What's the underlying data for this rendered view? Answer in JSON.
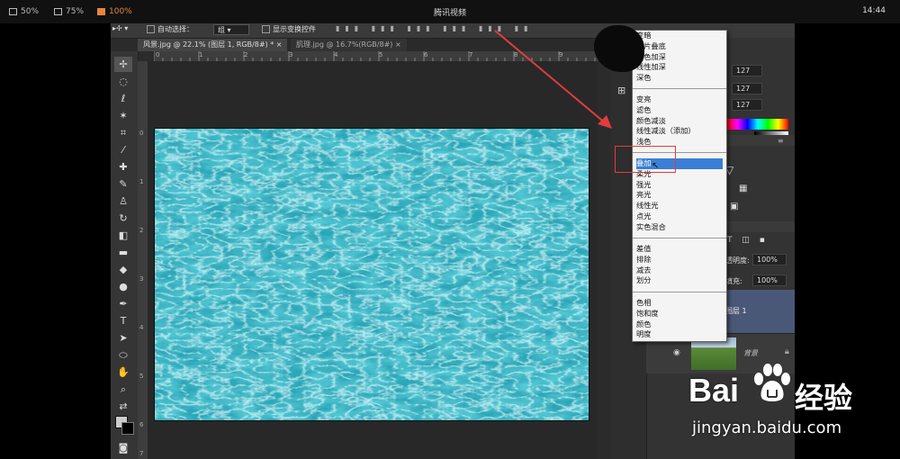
{
  "player": {
    "title": "腾讯视频",
    "clock": "14:44",
    "zoom_options": [
      {
        "label": "50%",
        "active": false
      },
      {
        "label": "75%",
        "active": false
      },
      {
        "label": "100%",
        "active": true
      }
    ]
  },
  "options_bar": {
    "auto_select_label": "自动选择：",
    "auto_select_value": "组",
    "show_transform_label": "显示变换控件"
  },
  "tabs": [
    {
      "label": "风景.jpg @ 22.1% (图层 1, RGB/8#) *",
      "close": "×",
      "active": true
    },
    {
      "label": "肌理.jpg @ 16.7%(RGB/8#)",
      "close": "×",
      "active": false
    }
  ],
  "rulers": {
    "h_ticks": [
      "0",
      "1",
      "2",
      "3",
      "4",
      "5",
      "6",
      "7",
      "8",
      "9",
      "1"
    ],
    "v_ticks": [
      "0",
      "1",
      "2",
      "3",
      "4",
      "5",
      "6",
      "7"
    ]
  },
  "panels": {
    "color_values": [
      "127",
      "127",
      "127"
    ],
    "opacity_label": "不透明度:",
    "opacity_value": "100%",
    "fill_label": "填充:",
    "fill_value": "100%",
    "layer1_name": "图层 1",
    "bg_layer_name": "背景"
  },
  "blend_menu": {
    "groups": [
      [
        "变暗",
        "正片叠底",
        "颜色加深",
        "线性加深",
        "深色"
      ],
      [
        "变亮",
        "滤色",
        "颜色减淡",
        "线性减淡（添加）",
        "浅色"
      ],
      [
        "叠加",
        "柔光",
        "强光",
        "亮光",
        "线性光",
        "点光",
        "实色混合"
      ],
      [
        "差值",
        "排除",
        "减去",
        "划分"
      ],
      [
        "色相",
        "饱和度",
        "颜色",
        "明度"
      ]
    ],
    "highlighted": "叠加"
  },
  "watermark": {
    "brand_1": "Bai",
    "brand_2": "经验",
    "url": "jingyan.baidu.com"
  },
  "colors": {
    "highlight_blue": "#3a7fd5",
    "annotation_red": "#e23c3c",
    "accent_orange": "#e8843c",
    "texture_teal": "#2aa7b8"
  }
}
